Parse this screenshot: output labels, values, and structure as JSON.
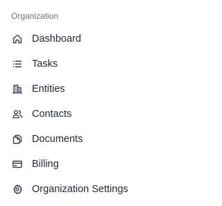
{
  "sidebar": {
    "section_title": "Organization",
    "items": [
      {
        "label": "Dashboard",
        "icon": "home-icon"
      },
      {
        "label": "Tasks",
        "icon": "list-icon"
      },
      {
        "label": "Entities",
        "icon": "building-icon"
      },
      {
        "label": "Contacts",
        "icon": "users-icon"
      },
      {
        "label": "Documents",
        "icon": "documents-icon"
      },
      {
        "label": "Billing",
        "icon": "credit-card-icon"
      },
      {
        "label": "Organization Settings",
        "icon": "gear-icon"
      }
    ]
  },
  "colors": {
    "text": "#1f2937",
    "muted": "#6b7280",
    "icon": "#374151",
    "background": "#ffffff"
  }
}
